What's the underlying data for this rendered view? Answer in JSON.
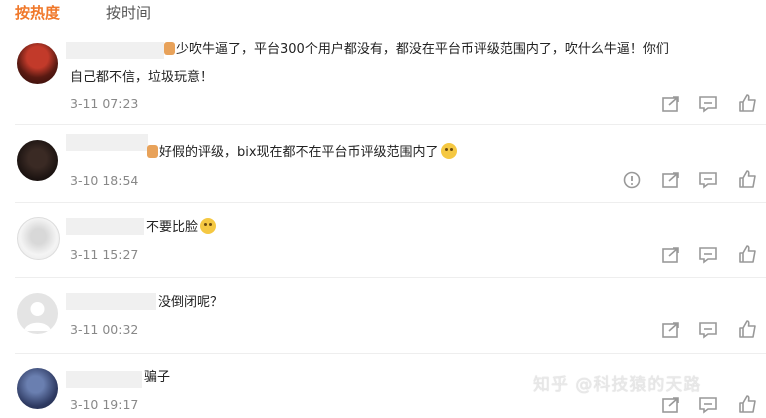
{
  "tabs": {
    "hot": "按热度",
    "time": "按时间"
  },
  "comments": [
    {
      "text_line1": "少吹牛逼了，平台300个用户都没有，都没在平台币评级范围内了，吹什么牛逼！你们",
      "text_line2": "自己都不信，垃圾玩意！",
      "time": "3-11 07:23",
      "emoji": "",
      "icons": [
        "share-icon",
        "reply-icon",
        "like-icon"
      ]
    },
    {
      "text_line1": "好假的评级，bix现在都不在平台币评级范围内了",
      "time": "3-10 18:54",
      "emoji": "laughing-tears-emoji",
      "icons": [
        "report-icon",
        "share-icon",
        "reply-icon",
        "like-icon"
      ]
    },
    {
      "text_line1": "不要比脸",
      "time": "3-11 15:27",
      "emoji": "smile-emoji",
      "icons": [
        "share-icon",
        "reply-icon",
        "like-icon"
      ]
    },
    {
      "text_line1": "没倒闭呢？",
      "time": "3-11 00:32",
      "emoji": "",
      "icons": [
        "share-icon",
        "reply-icon",
        "like-icon"
      ]
    },
    {
      "text_line1": "骗子",
      "time": "3-10 19:17",
      "emoji": "",
      "icons": [
        "share-icon",
        "reply-icon",
        "like-icon"
      ]
    }
  ],
  "watermark": "知乎 @科技猿的天路",
  "colors": {
    "active_tab": "#f0782a",
    "text": "#222222",
    "meta": "#888888"
  }
}
